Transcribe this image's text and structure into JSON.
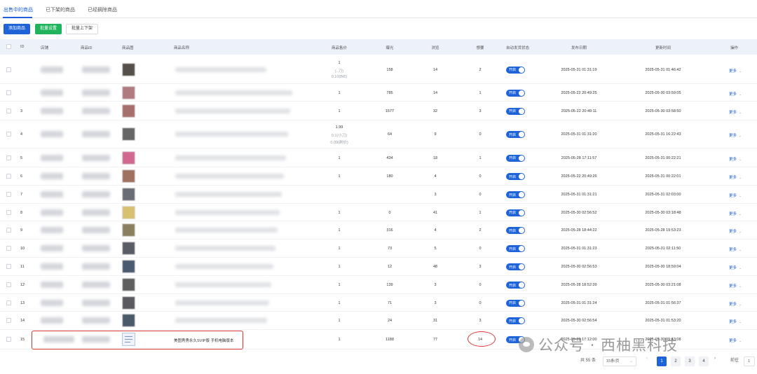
{
  "tabs": [
    {
      "label": "出售中的商品",
      "active": true
    },
    {
      "label": "已下架的商品",
      "active": false
    },
    {
      "label": "已经摘除商品",
      "active": false
    }
  ],
  "toolbar": {
    "add": "添加商品",
    "batch_settings": "批量设置",
    "batch_shelf": "批量上下架"
  },
  "columns": {
    "id": "ID",
    "shop": "店铺",
    "product_id": "商品ID",
    "image": "商品图",
    "name": "商品名称",
    "price": "商品售价",
    "exposure": "曝光",
    "views": "浏览",
    "want": "想要",
    "auto_ship": "自动发货状态",
    "publish_date": "发布日期",
    "update_time": "更新时间",
    "action": "操作"
  },
  "toggle_label": "开启",
  "more_label": "更多",
  "rows": [
    {
      "id": "",
      "name": "",
      "price": "1",
      "price2": "(..刀)",
      "price3": "0.10(Bt5)",
      "exposure": "158",
      "views": "14",
      "want": "2",
      "publish": "2025-05-31 01:31:19",
      "update": "2025-05-31 01:46:42"
    },
    {
      "id": "",
      "name": "",
      "price": "1",
      "price2": "",
      "price3": "",
      "exposure": "785",
      "views": "14",
      "want": "1",
      "publish": "2025-05-22 20:49:25",
      "update": "2025-05-30 03:59:05"
    },
    {
      "id": "3",
      "name": "",
      "price": "1",
      "price2": "",
      "price3": "",
      "exposure": "1577",
      "views": "32",
      "want": "3",
      "publish": "2025-05-22 20:49:11",
      "update": "2025-05-30 03:58:50"
    },
    {
      "id": "4",
      "name": "",
      "price": "1.99",
      "price2": "0.1(小刀)",
      "price3": "0.09(刷价)",
      "exposure": "64",
      "views": "9",
      "want": "0",
      "publish": "2025-05-31 01:31:20",
      "update": "2025-05-31 16:22:43"
    },
    {
      "id": "5",
      "name": "",
      "price": "1",
      "price2": "",
      "price3": "",
      "exposure": "434",
      "views": "18",
      "want": "1",
      "publish": "2025-05-28 17:11:57",
      "update": "2025-05-31 00:22:21"
    },
    {
      "id": "6",
      "name": "",
      "price": "1",
      "price2": "",
      "price3": "",
      "exposure": "180",
      "views": "4",
      "want": "0",
      "publish": "2025-05-22 20:49:26",
      "update": "2025-05-31 00:22:01"
    },
    {
      "id": "7",
      "name": "",
      "price": "",
      "price2": "",
      "price3": "",
      "exposure": "",
      "views": "3",
      "want": "0",
      "publish": "2025-05-31 01:31:21",
      "update": "2025-05-31 02:03:00"
    },
    {
      "id": "8",
      "name": "",
      "price": "1",
      "price2": "",
      "price3": "",
      "exposure": "0",
      "views": "41",
      "want": "1",
      "publish": "2025-05-30 02:56:52",
      "update": "2025-05-30 03:18:48"
    },
    {
      "id": "9",
      "name": "",
      "price": "1",
      "price2": "",
      "price3": "",
      "exposure": "316",
      "views": "4",
      "want": "2",
      "publish": "2025-05-28 18:44:22",
      "update": "2025-05-28 19:53:23"
    },
    {
      "id": "10",
      "name": "",
      "price": "1",
      "price2": "",
      "price3": "",
      "exposure": "73",
      "views": "5",
      "want": "0",
      "publish": "2025-05-31 01:31:23",
      "update": "2025-05-31 02:11:50"
    },
    {
      "id": "11",
      "name": "",
      "price": "1",
      "price2": "",
      "price3": "",
      "exposure": "12",
      "views": "48",
      "want": "3",
      "publish": "2025-05-30 02:56:53",
      "update": "2025-05-30 18:59:04"
    },
    {
      "id": "12",
      "name": "",
      "price": "1",
      "price2": "",
      "price3": "",
      "exposure": "139",
      "views": "3",
      "want": "0",
      "publish": "2025-05-28 18:52:39",
      "update": "2025-05-30 03:21:08"
    },
    {
      "id": "13",
      "name": "",
      "price": "1",
      "price2": "",
      "price3": "",
      "exposure": "71",
      "views": "3",
      "want": "0",
      "publish": "2025-05-31 01:31:24",
      "update": "2025-05-31 01:56:37"
    },
    {
      "id": "14",
      "name": "",
      "price": "1",
      "price2": "",
      "price3": "",
      "exposure": "24",
      "views": "31",
      "want": "3",
      "publish": "2025-05-30 02:56:54",
      "update": "2025-05-31 01:53:20"
    },
    {
      "id": "15",
      "name": "美图秀秀永久SVIP版 手机电脑版本",
      "price": "1",
      "price2": "",
      "price3": "",
      "exposure": "1188",
      "views": "77",
      "want": "14",
      "publish": "2025-05-28 17:12:00",
      "update": "2025-05-30 09:43:08"
    }
  ],
  "pagination": {
    "total": "共 55 条",
    "page_size": "15条/页",
    "pages": [
      "1",
      "2",
      "3",
      "4"
    ],
    "active": "1",
    "goto": "前往",
    "goto_value": "1"
  },
  "watermark": "公众号 · 西柚黑科技",
  "colors": {
    "accent": "#1f63d8",
    "green": "#1fb45c",
    "highlight": "#d93535"
  }
}
